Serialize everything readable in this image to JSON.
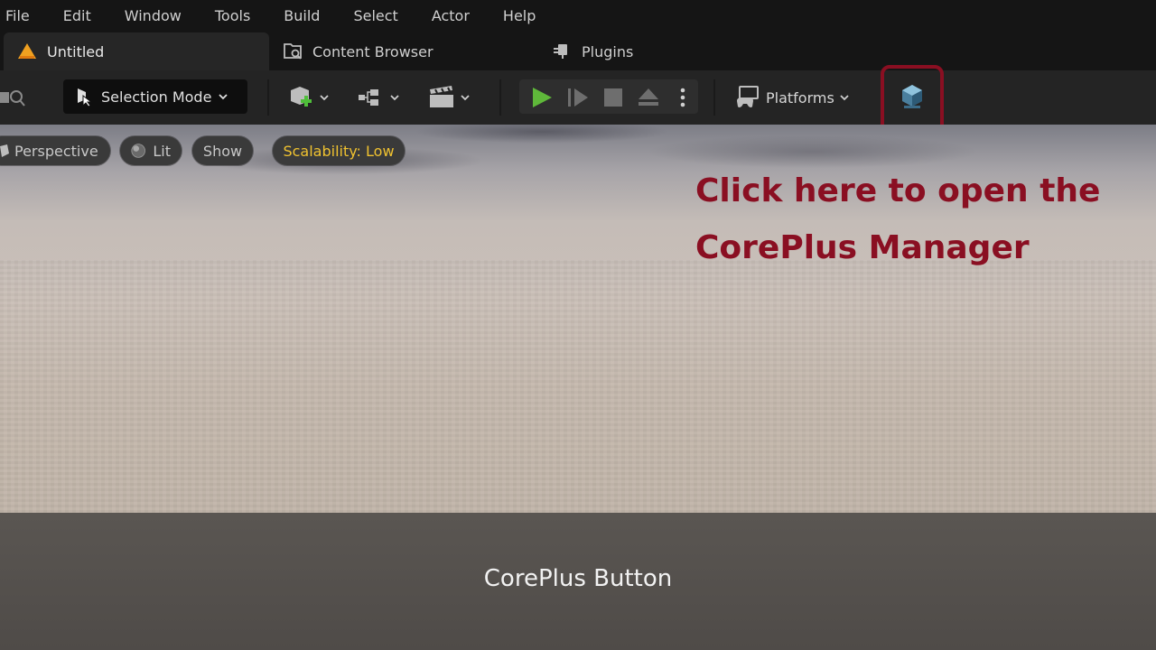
{
  "menu": {
    "items": [
      "File",
      "Edit",
      "Window",
      "Tools",
      "Build",
      "Select",
      "Actor",
      "Help"
    ]
  },
  "tabs": [
    {
      "label": "Untitled",
      "icon": "warning-icon"
    },
    {
      "label": "Content Browser",
      "icon": "content-browser-icon"
    },
    {
      "label": "Plugins",
      "icon": "plugin-icon"
    }
  ],
  "toolbar": {
    "mode_label": "Selection Mode",
    "platforms_label": "Platforms",
    "accent_play": "#5fb83a",
    "highlight_color": "#8a0f22"
  },
  "viewport": {
    "perspective_label": "Perspective",
    "lit_label": "Lit",
    "show_label": "Show",
    "scalability_label": "Scalability: Low"
  },
  "annotation": {
    "line1": "Click here to open the",
    "line2": "CorePlus Manager"
  },
  "caption": "CorePlus Button"
}
